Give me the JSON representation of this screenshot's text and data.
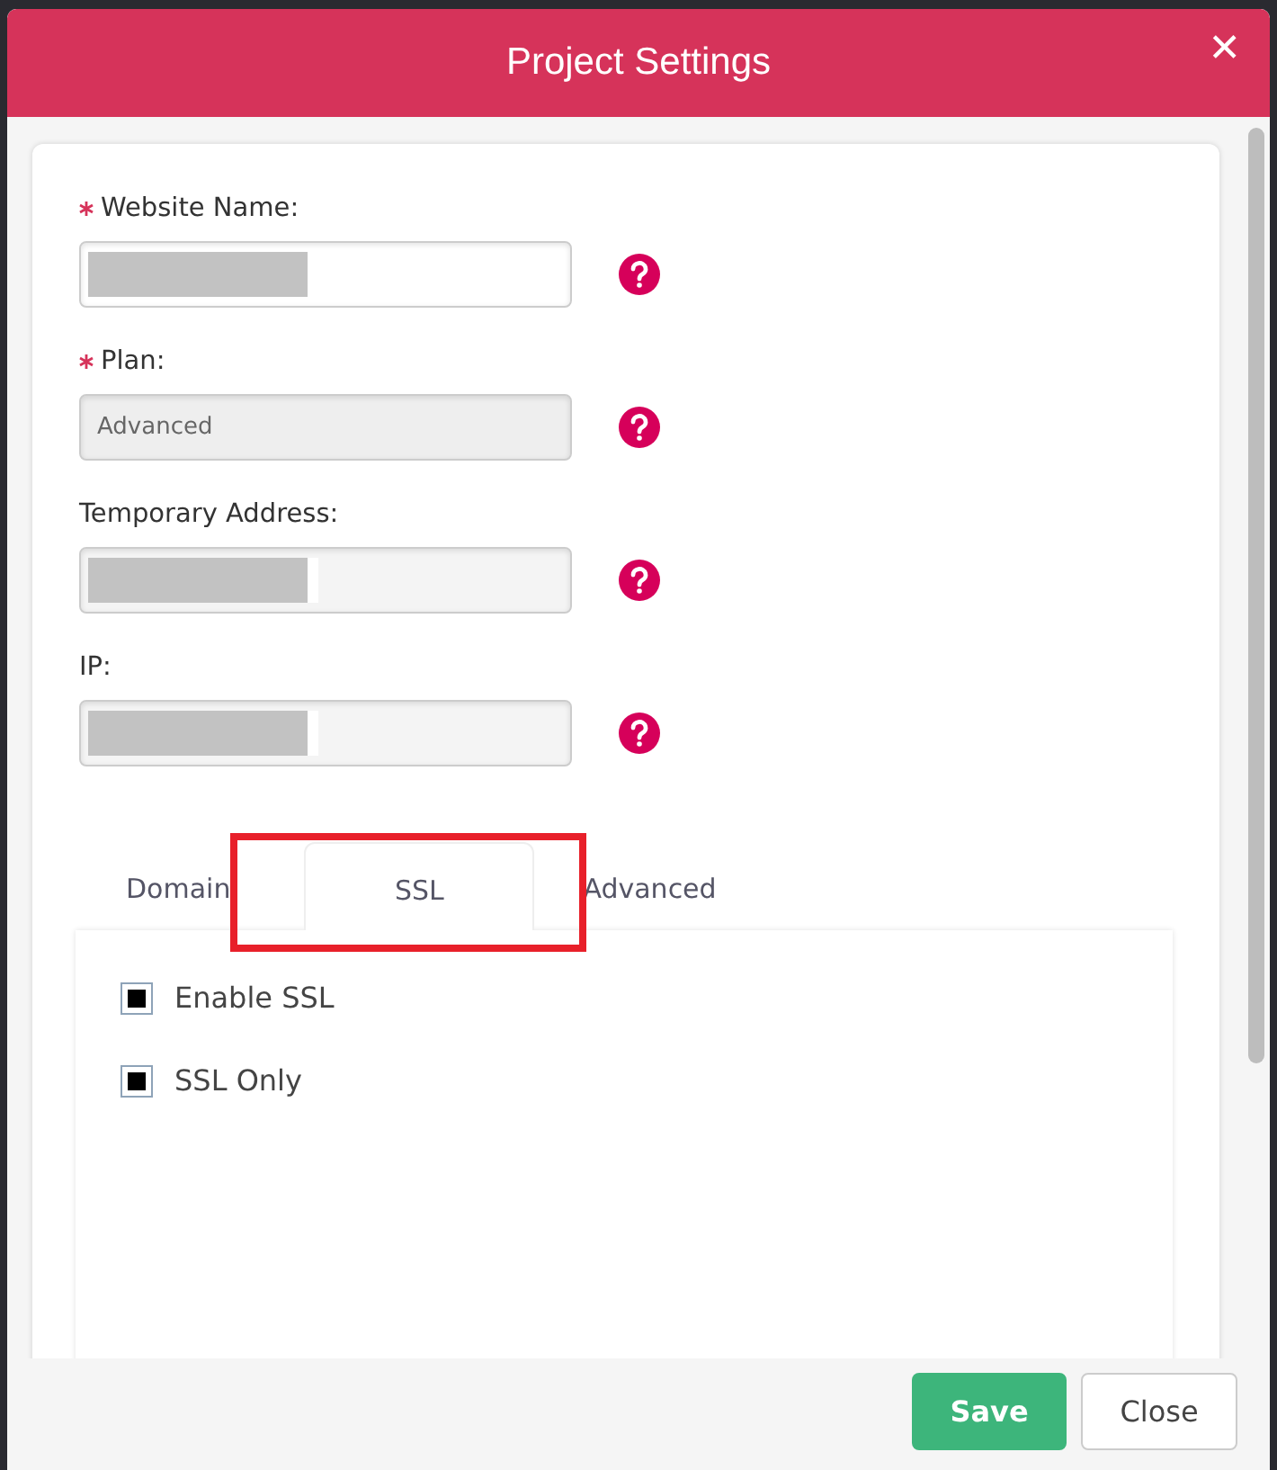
{
  "dialog": {
    "title": "Project Settings",
    "close_icon": "✕"
  },
  "fields": [
    {
      "label": "Website Name:",
      "required": true,
      "redacted": true,
      "disabled": false
    },
    {
      "label": "Plan:",
      "required": true,
      "value": "Advanced",
      "redacted": false,
      "disabled": true
    },
    {
      "label": "Temporary Address:",
      "required": false,
      "redacted": true,
      "disabled": true
    },
    {
      "label": "IP:",
      "required": false,
      "redacted": true,
      "disabled": true
    }
  ],
  "tabs": [
    {
      "label": "Domain",
      "selected": false,
      "highlighted": false
    },
    {
      "label": "SSL",
      "selected": true,
      "highlighted": true
    },
    {
      "label": "Advanced",
      "selected": false,
      "highlighted": false
    }
  ],
  "options": [
    {
      "label": "Enable SSL",
      "checked": true
    },
    {
      "label": "SSL Only",
      "checked": true
    }
  ],
  "buttons": [
    {
      "label": "Save",
      "kind": "primary"
    },
    {
      "label": "Close",
      "kind": "secondary"
    }
  ]
}
